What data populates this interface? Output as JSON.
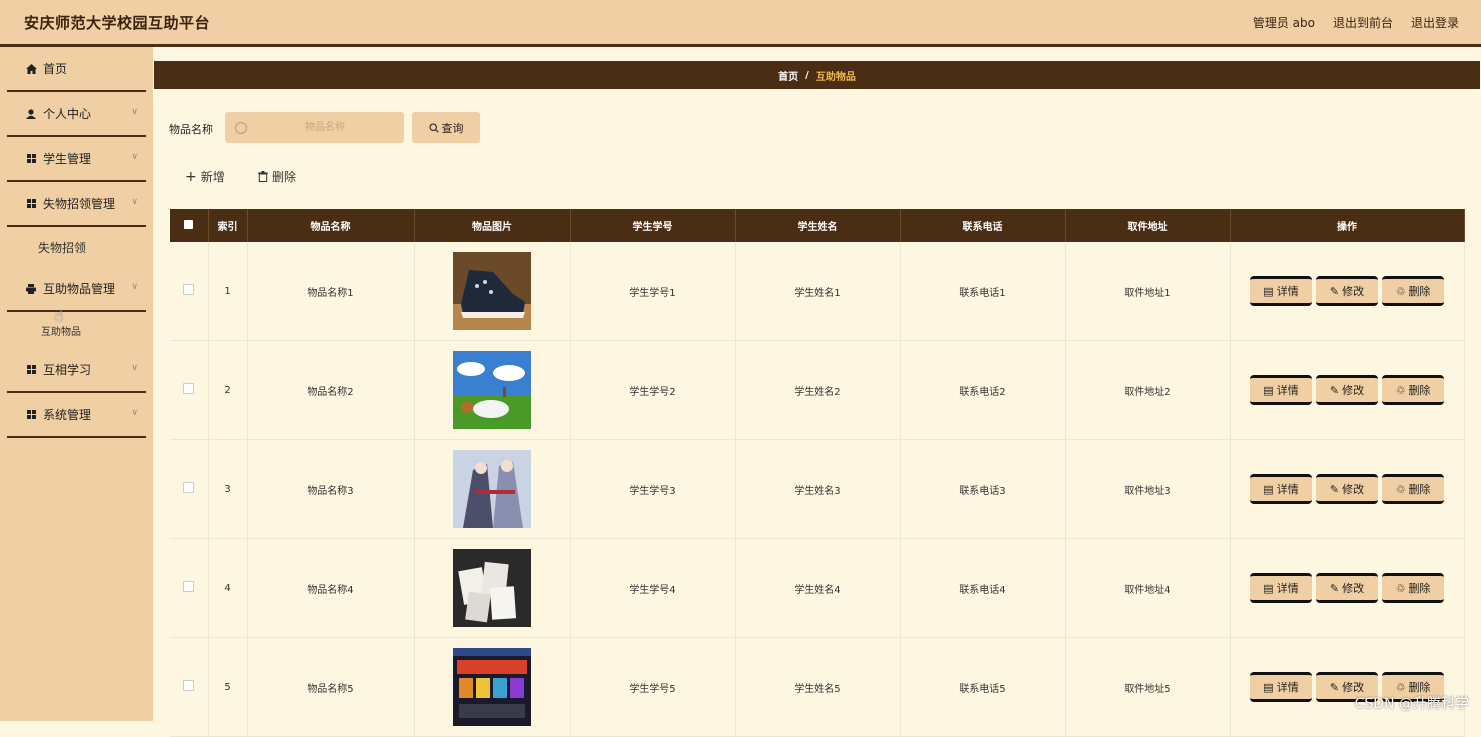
{
  "header": {
    "title": "安庆师范大学校园互助平台",
    "admin_label": "管理员 abo",
    "back_front_label": "退出到前台",
    "logout_label": "退出登录"
  },
  "sidebar": {
    "home": "首页",
    "personal_center": "个人中心",
    "student_mgmt": "学生管理",
    "lost_found_mgmt": "失物招领管理",
    "lost_found": "失物招领",
    "mutual_items_mgmt": "互助物品管理",
    "mutual_items": "互助物品",
    "mutual_study": "互相学习",
    "system_mgmt": "系统管理"
  },
  "breadcrumb": {
    "home": "首页",
    "separator": "/",
    "current": "互助物品"
  },
  "search": {
    "label": "物品名称",
    "placeholder": "物品名称",
    "query_label": "查询"
  },
  "actions": {
    "add_label": "新增",
    "delete_label": "删除"
  },
  "table": {
    "headers": [
      "索引",
      "物品名称",
      "物品图片",
      "学生学号",
      "学生姓名",
      "联系电话",
      "取件地址",
      "操作"
    ],
    "rows": [
      {
        "index": "1",
        "name": "物品名称1",
        "student_no": "学生学号1",
        "student_name": "学生姓名1",
        "phone": "联系电话1",
        "address": "取件地址1",
        "image": "sneakers-photo"
      },
      {
        "index": "2",
        "name": "物品名称2",
        "student_no": "学生学号2",
        "student_name": "学生姓名2",
        "phone": "联系电话2",
        "address": "取件地址2",
        "image": "meadow-photo"
      },
      {
        "index": "3",
        "name": "物品名称3",
        "student_no": "学生学号3",
        "student_name": "学生姓名3",
        "phone": "联系电话3",
        "address": "取件地址3",
        "image": "anime-art-photo"
      },
      {
        "index": "4",
        "name": "物品名称4",
        "student_no": "学生学号4",
        "student_name": "学生姓名4",
        "phone": "联系电话4",
        "address": "取件地址4",
        "image": "brochures-photo"
      },
      {
        "index": "5",
        "name": "物品名称5",
        "student_no": "学生学号5",
        "student_name": "学生姓名5",
        "phone": "联系电话5",
        "address": "取件地址5",
        "image": "website-screenshot"
      }
    ],
    "op_detail": "详情",
    "op_edit": "修改",
    "op_delete": "删除"
  },
  "watermark": "CSDN @升腾科学"
}
